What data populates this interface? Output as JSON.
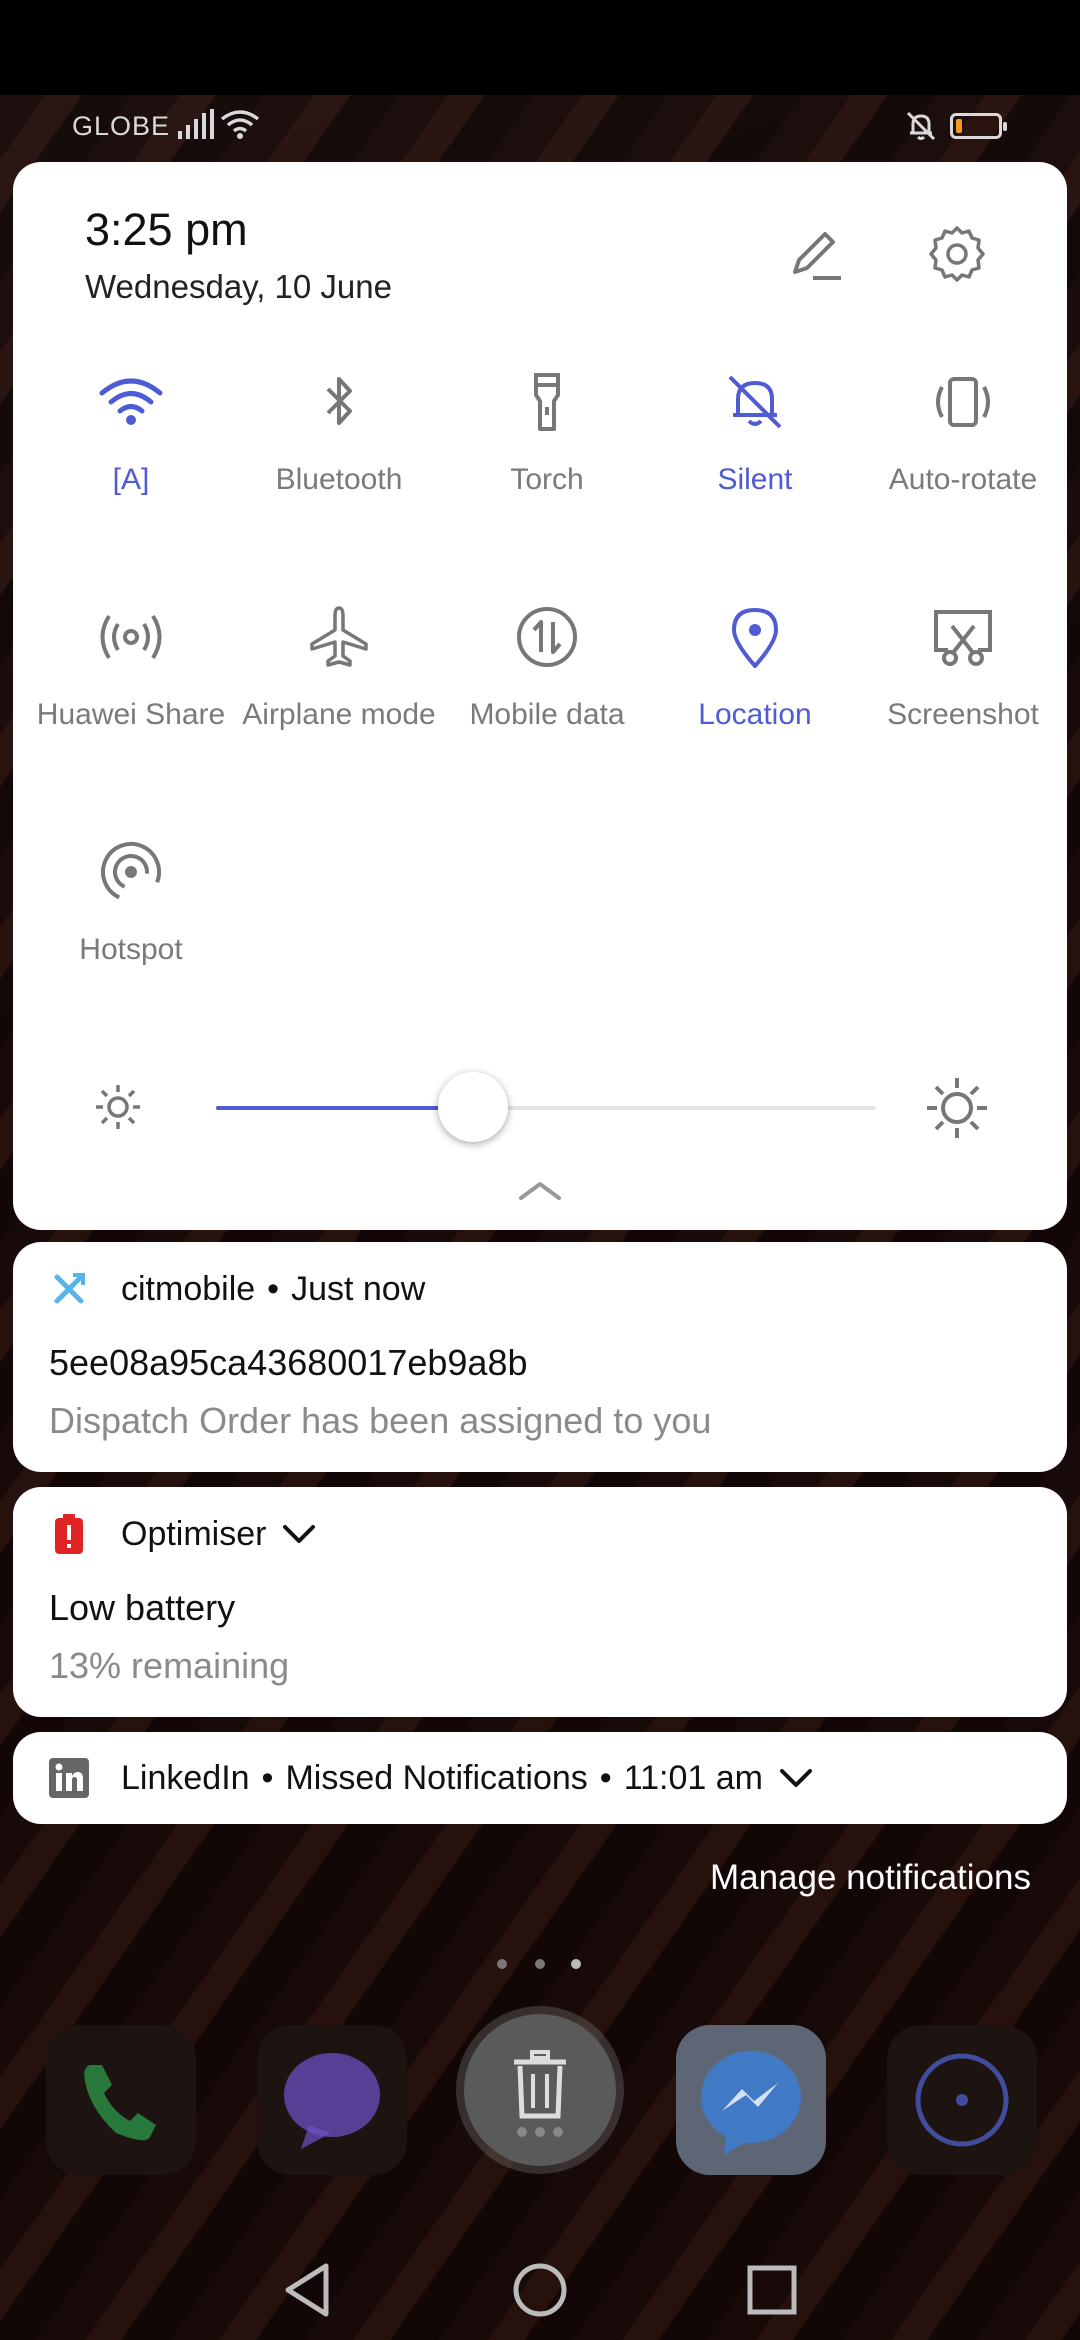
{
  "status_bar": {
    "carrier": "GLOBE",
    "battery_level": 0.13
  },
  "quick_settings": {
    "time": "3:25 pm",
    "date": "Wednesday, 10 June",
    "accent_color": "#4f5bd5",
    "tiles": [
      {
        "label": "[A]",
        "icon": "wifi-icon",
        "active": true
      },
      {
        "label": "Bluetooth",
        "icon": "bluetooth-icon",
        "active": false
      },
      {
        "label": "Torch",
        "icon": "torch-icon",
        "active": false
      },
      {
        "label": "Silent",
        "icon": "bell-off-icon",
        "active": true
      },
      {
        "label": "Auto-rotate",
        "icon": "auto-rotate-icon",
        "active": false
      },
      {
        "label": "Huawei Share",
        "icon": "huawei-share-icon",
        "active": false
      },
      {
        "label": "Airplane mode",
        "icon": "airplane-icon",
        "active": false
      },
      {
        "label": "Mobile data",
        "icon": "mobile-data-icon",
        "active": false
      },
      {
        "label": "Location",
        "icon": "location-pin-icon",
        "active": true
      },
      {
        "label": "Screenshot",
        "icon": "screenshot-icon",
        "active": false
      },
      {
        "label": "Hotspot",
        "icon": "hotspot-icon",
        "active": false
      }
    ],
    "brightness": 0.39
  },
  "notifications": [
    {
      "app": "citmobile",
      "time": "Just now",
      "title": "5ee08a95ca43680017eb9a8b",
      "body": "Dispatch Order has been assigned to you"
    },
    {
      "app": "Optimiser",
      "title": "Low battery",
      "body": "13% remaining"
    },
    {
      "app": "LinkedIn",
      "subtext": "Missed Notifications",
      "time": "11:01 am"
    }
  ],
  "manage_notifications": "Manage notifications"
}
